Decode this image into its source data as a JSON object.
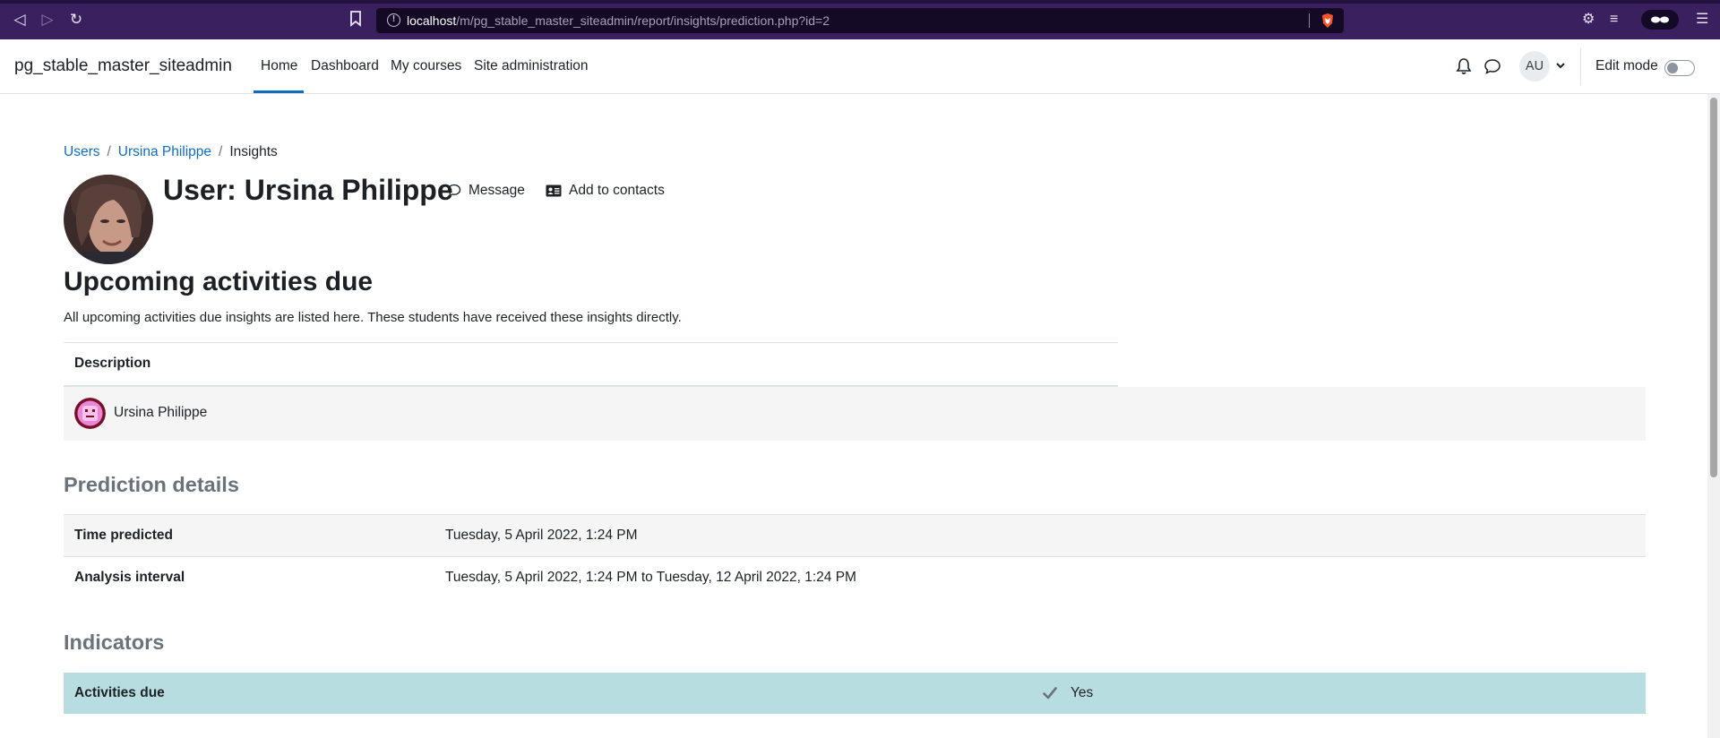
{
  "browser": {
    "url_host": "localhost",
    "url_path": "/m/pg_stable_master_siteadmin/report/insights/prediction.php?id=2"
  },
  "navbar": {
    "site_name": "pg_stable_master_siteadmin",
    "links": [
      "Home",
      "Dashboard",
      "My courses",
      "Site administration"
    ],
    "active": "Home",
    "user_initials": "AU",
    "edit_mode_label": "Edit mode",
    "edit_mode_on": false
  },
  "breadcrumb": {
    "items": [
      "Users",
      "Ursina Philippe"
    ],
    "current": "Insights"
  },
  "header": {
    "title": "User: Ursina Philippe",
    "message_label": "Message",
    "add_contacts_label": "Add to contacts"
  },
  "insight": {
    "title": "Upcoming activities due",
    "description": "All upcoming activities due insights are listed here. These students have received these insights directly.",
    "table_header": "Description",
    "student_name": "Ursina Philippe"
  },
  "prediction_details": {
    "title": "Prediction details",
    "rows": [
      {
        "label": "Time predicted",
        "value": "Tuesday, 5 April 2022, 1:24 PM"
      },
      {
        "label": "Analysis interval",
        "value": "Tuesday, 5 April 2022, 1:24 PM to Tuesday, 12 April 2022, 1:24 PM"
      }
    ]
  },
  "indicators": {
    "title": "Indicators",
    "rows": [
      {
        "label": "Activities due",
        "value": "Yes",
        "icon": "check-icon"
      }
    ]
  },
  "colors": {
    "accent": "#0f6cbf",
    "browser_bar": "#3b2060",
    "indicator_row": "#b8dde1"
  }
}
